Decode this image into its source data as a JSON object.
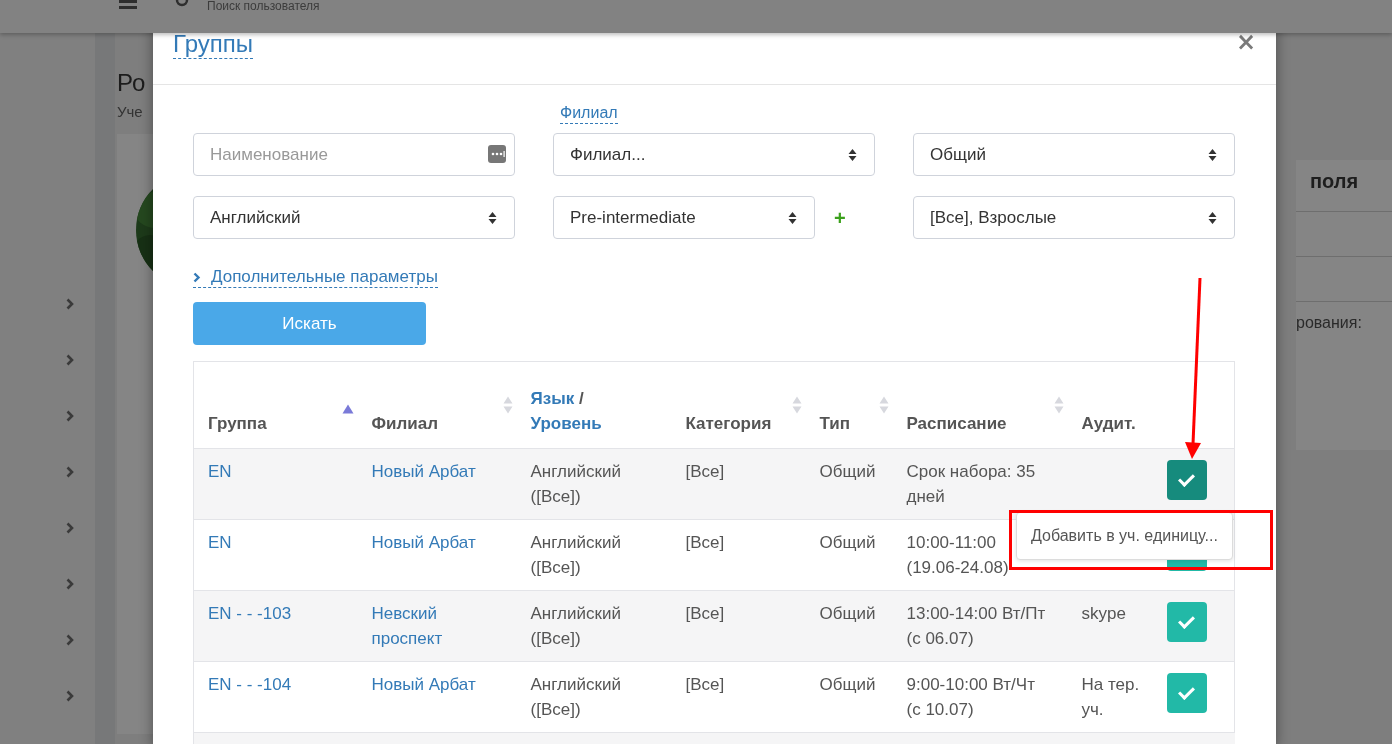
{
  "page": {
    "search_placeholder": "Поиск пользователя",
    "title": "Ро",
    "subtitle": "Уче",
    "side_heading": "поля",
    "side_text": "рования:"
  },
  "dialog": {
    "title": "Группы",
    "close": "×",
    "branch_label": "Филиал",
    "fields": [
      {
        "kind": "text",
        "placeholder": "Наименование"
      },
      {
        "kind": "select",
        "value": "Филиал..."
      },
      {
        "kind": "select",
        "value": "Общий"
      },
      {
        "kind": "select",
        "value": "Английский"
      },
      {
        "kind": "select",
        "value": "Pre-intermediate",
        "add": "+"
      },
      {
        "kind": "select",
        "value": "[Все], Взрослые"
      }
    ],
    "more_params": "Дополнительные параметры",
    "search_button": "Искать",
    "table": {
      "columns": [
        {
          "parts": [
            {
              "text": "Группа",
              "link": false
            }
          ],
          "sorted": true
        },
        {
          "parts": [
            {
              "text": "Филиал",
              "link": false
            }
          ],
          "sorted": false
        },
        {
          "parts": [
            {
              "text": "Язык",
              "link": true
            },
            {
              "text": "/",
              "link": false
            },
            {
              "text": "Уровень",
              "link": true
            }
          ]
        },
        {
          "parts": [
            {
              "text": "Категория",
              "link": false
            }
          ],
          "sorted": false
        },
        {
          "parts": [
            {
              "text": "Тип",
              "link": false
            }
          ],
          "sorted": false
        },
        {
          "parts": [
            {
              "text": "Расписание",
              "link": false
            }
          ],
          "sorted": false
        },
        {
          "parts": [
            {
              "text": "Аудит.",
              "link": false
            }
          ]
        }
      ],
      "rows": [
        {
          "group": "EN",
          "branch": "Новый Арбат",
          "language": "Английский\n([Все])",
          "category": "[Все]",
          "type": "Общий",
          "schedule": "Срок набора: 35\nдней",
          "room": "",
          "hovered": true
        },
        {
          "group": "EN",
          "branch": "Новый Арбат",
          "language": "Английский\n([Все])",
          "category": "[Все]",
          "type": "Общий",
          "schedule": "10:00-11:00\n(19.06-24.08)",
          "room": "",
          "hovered": false
        },
        {
          "group": "EN - - -103",
          "branch": "Невский\nпроспект",
          "language": "Английский\n([Все])",
          "category": "[Все]",
          "type": "Общий",
          "schedule": "13:00-14:00 Вт/Пт\n(с 06.07)",
          "room": "skype",
          "hovered": false
        },
        {
          "group": "EN - - -104",
          "branch": "Новый Арбат",
          "language": "Английский\n([Все])",
          "category": "[Все]",
          "type": "Общий",
          "schedule": "9:00-10:00 Вт/Чт\n(с 10.07)",
          "room": "На тер.\nуч.",
          "hovered": false
        }
      ]
    },
    "tooltip": "Добавить в уч. единицу..."
  }
}
